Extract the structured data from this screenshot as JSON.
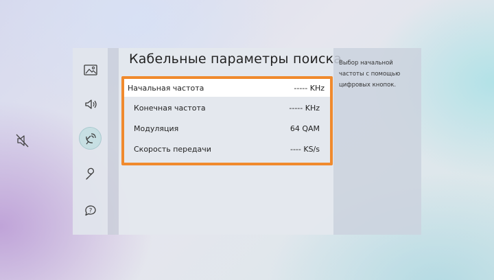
{
  "header": {
    "title": "Кабельные  параметры поиска"
  },
  "description": "Выбор начальной частоты с помощью цифровых кнопок.",
  "settings": [
    {
      "label": "Начальная частота",
      "value": "----- KHz"
    },
    {
      "label": "Конечная частота",
      "value": "----- KHz"
    },
    {
      "label": "Модуляция",
      "value": "64 QAM"
    },
    {
      "label": "Скорость передачи",
      "value": "---- KS/s"
    }
  ],
  "sidebar": {
    "icons": [
      "picture-icon",
      "sound-icon",
      "broadcasting-icon",
      "support-icon",
      "help-icon"
    ],
    "active": "broadcasting-icon"
  },
  "colors": {
    "highlight_frame": "#f08a2d",
    "focused_row": "#ffffff",
    "icon_stroke": "#3a3a3a"
  }
}
